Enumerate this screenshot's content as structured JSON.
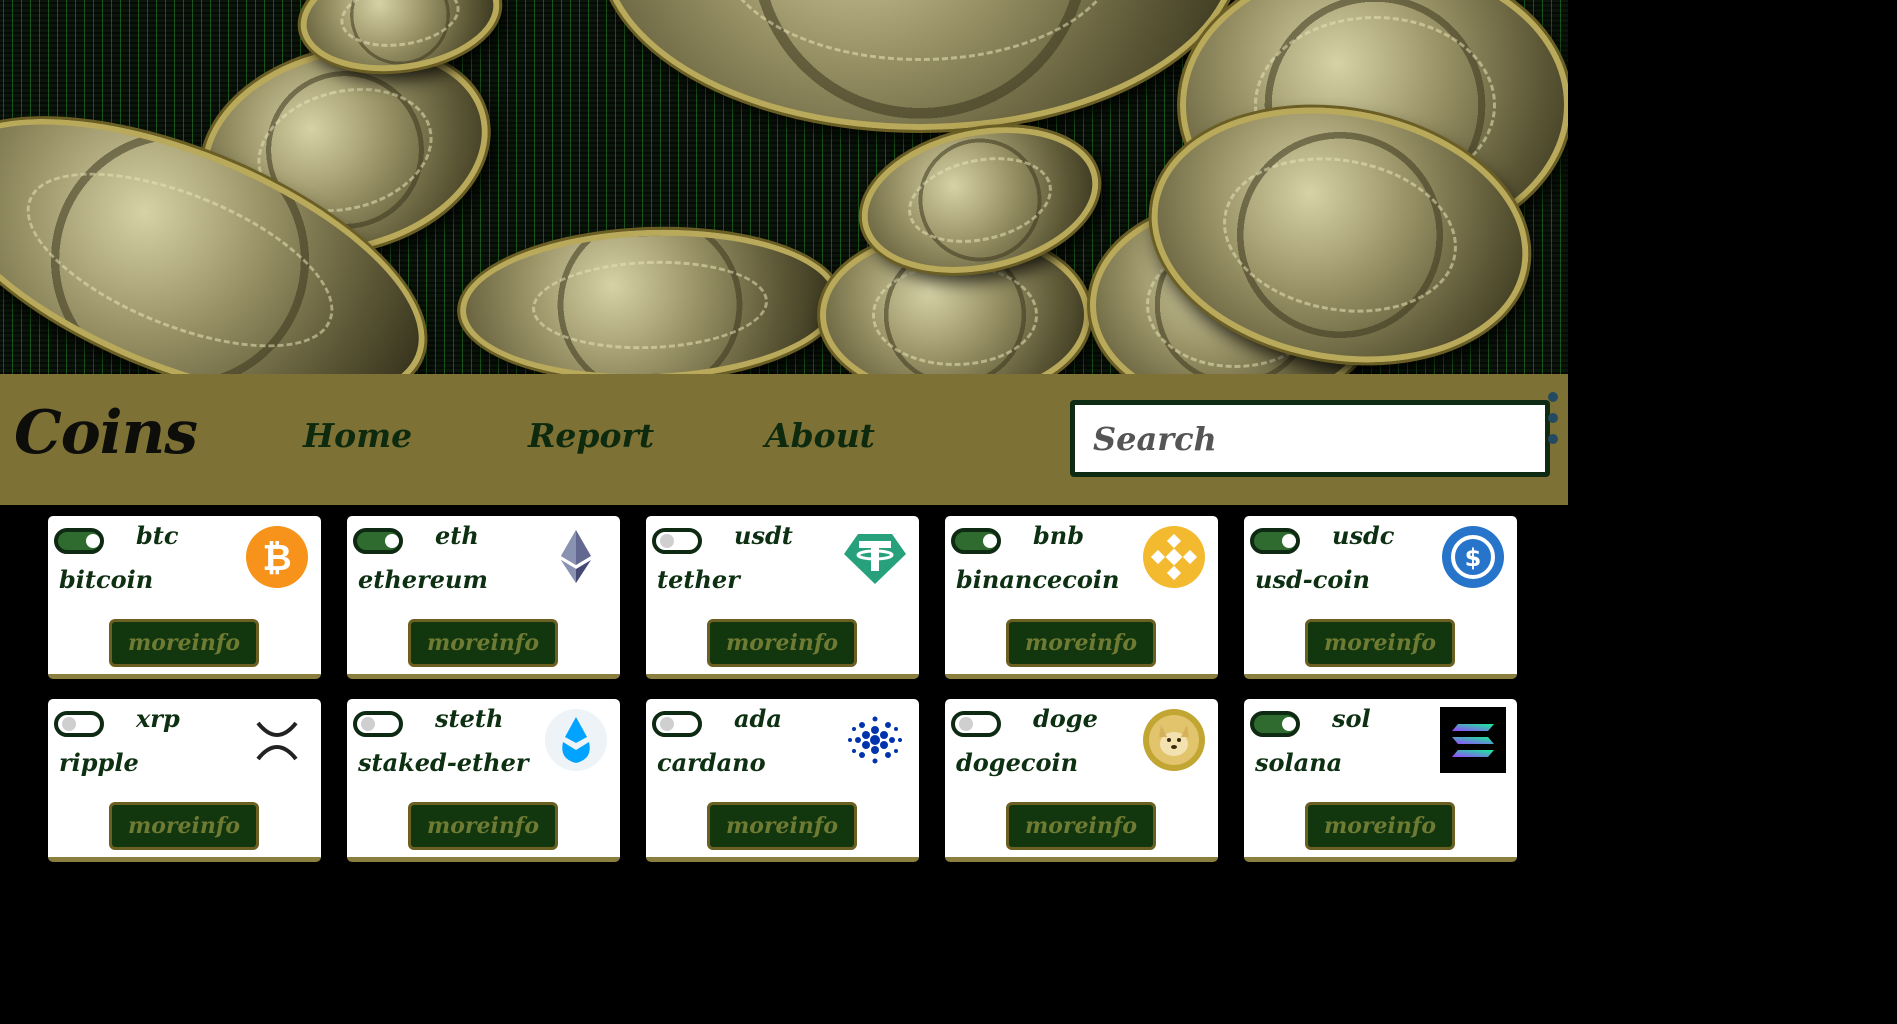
{
  "header": {
    "brand": "Coins",
    "nav": [
      {
        "label": "Home"
      },
      {
        "label": "Report"
      },
      {
        "label": "About"
      }
    ],
    "search_placeholder": "Search"
  },
  "colors": {
    "navbar": "#7d7135",
    "accent_green": "#12370f",
    "toggle_on": "#2f6b2f"
  },
  "coins": [
    {
      "symbol": "btc",
      "name": "bitcoin",
      "toggled": true,
      "icon": "bitcoin-logo-icon",
      "button": "moreinfo"
    },
    {
      "symbol": "eth",
      "name": "ethereum",
      "toggled": true,
      "icon": "ethereum-logo-icon",
      "button": "moreinfo"
    },
    {
      "symbol": "usdt",
      "name": "tether",
      "toggled": false,
      "icon": "tether-logo-icon",
      "button": "moreinfo"
    },
    {
      "symbol": "bnb",
      "name": "binancecoin",
      "toggled": true,
      "icon": "binance-logo-icon",
      "button": "moreinfo"
    },
    {
      "symbol": "usdc",
      "name": "usd-coin",
      "toggled": true,
      "icon": "usd-coin-logo-icon",
      "button": "moreinfo"
    },
    {
      "symbol": "xrp",
      "name": "ripple",
      "toggled": false,
      "icon": "xrp-logo-icon",
      "button": "moreinfo"
    },
    {
      "symbol": "steth",
      "name": "staked-ether",
      "toggled": false,
      "icon": "staked-ether-logo-icon",
      "button": "moreinfo"
    },
    {
      "symbol": "ada",
      "name": "cardano",
      "toggled": false,
      "icon": "cardano-logo-icon",
      "button": "moreinfo"
    },
    {
      "symbol": "doge",
      "name": "dogecoin",
      "toggled": false,
      "icon": "dogecoin-logo-icon",
      "button": "moreinfo"
    },
    {
      "symbol": "sol",
      "name": "solana",
      "toggled": true,
      "icon": "solana-logo-icon",
      "button": "moreinfo"
    }
  ]
}
